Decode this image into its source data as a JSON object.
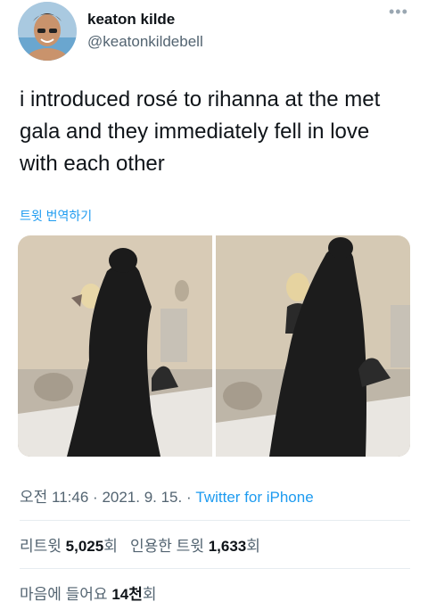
{
  "user": {
    "name": "keaton kilde",
    "handle": "@keatonkildebell"
  },
  "tweet": {
    "text": "i introduced rosé to rihanna at the met gala and they immediately fell in love with each other",
    "translate_label": "트윗 번역하기"
  },
  "meta": {
    "time": "오전 11:46",
    "date": "2021. 9. 15.",
    "separator": "·",
    "source": "Twitter for iPhone"
  },
  "stats": {
    "retweets_label": "리트윗",
    "retweets_count": "5,025",
    "retweets_unit": "회",
    "quotes_label": "인용한 트윗",
    "quotes_count": "1,633",
    "quotes_unit": "회",
    "likes_label": "마음에 들어요",
    "likes_count": "14천",
    "likes_unit": "회"
  },
  "icons": {
    "more": "more-horizontal-icon"
  }
}
